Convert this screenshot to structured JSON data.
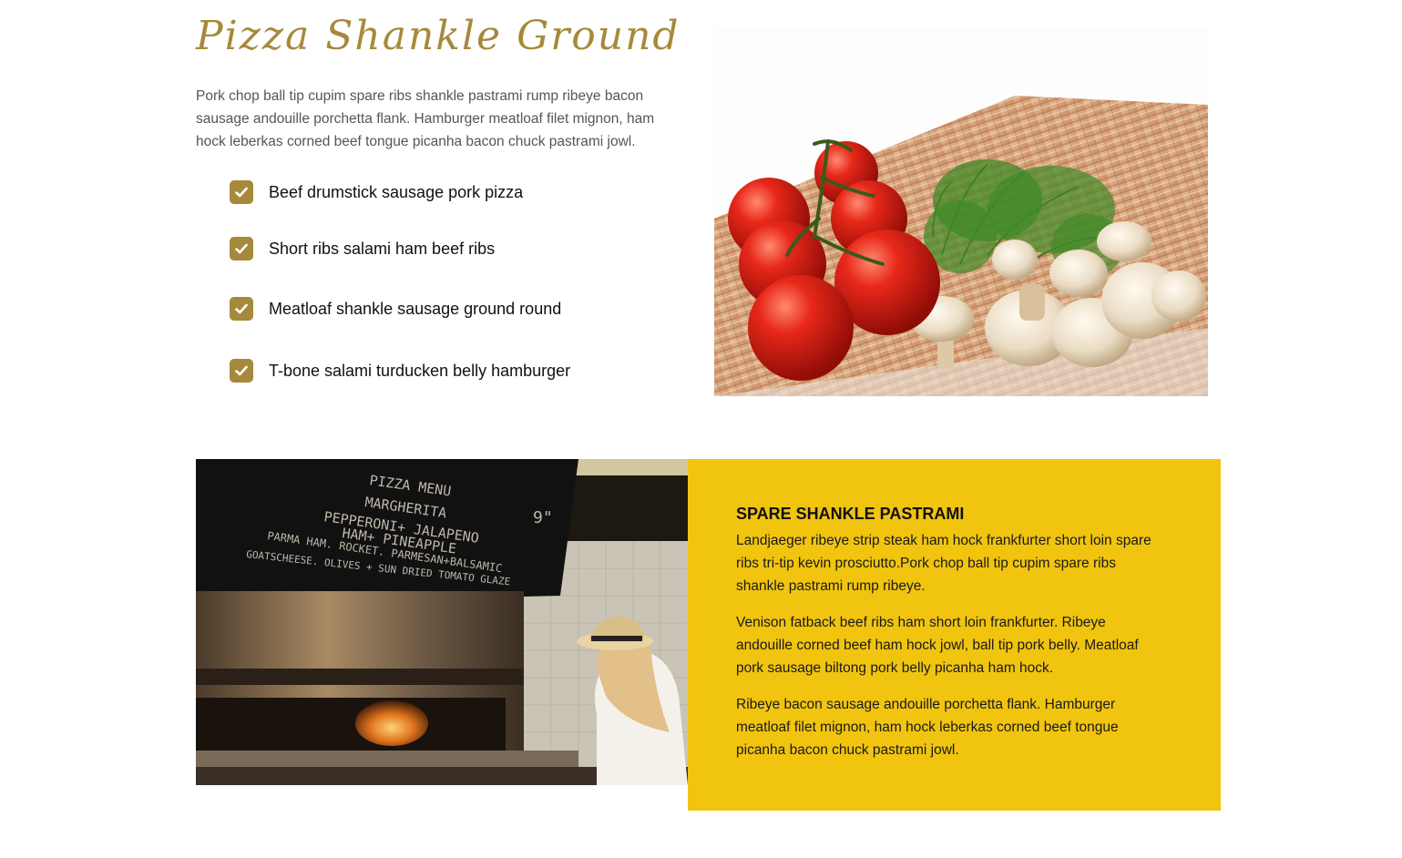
{
  "heading": {
    "title": "Pizza Shankle Ground",
    "intro": "Pork chop ball tip cupim spare ribs shankle pastrami rump ribeye bacon sausage andouille porchetta flank. Hamburger meatloaf filet mignon, ham hock leberkas corned beef tongue picanha bacon chuck pastrami jowl."
  },
  "checklist": {
    "icon": "check-icon",
    "items": [
      {
        "label": "Beef drumstick sausage pork pizza"
      },
      {
        "label": "Short ribs salami ham beef ribs"
      },
      {
        "label": "Meatloaf shankle sausage ground round"
      },
      {
        "label": "T-bone salami turducken belly hamburger"
      }
    ]
  },
  "images": {
    "vegetables": "tomatoes-dill-mushrooms-photo",
    "oven": "pizza-oven-chef-photo"
  },
  "menu_board": {
    "lines": [
      "PIZZA MENU",
      "MARGHERITA",
      "PEPPERONI+ JALAPENO",
      "HAM+ PINEAPPLE",
      "PARMA HAM. ROCKET. PARMESAN+BALSAMIC",
      "GOATSCHEESE. OLIVES + SUN DRIED TOMATO GLAZE"
    ],
    "size": "9\""
  },
  "info_card": {
    "title": "SPARE SHANKLE PASTRAMI",
    "paragraphs": [
      "Landjaeger ribeye strip steak ham hock frankfurter short loin spare ribs tri-tip kevin prosciutto.Pork chop ball tip cupim spare ribs shankle pastrami rump ribeye.",
      "Venison fatback beef ribs ham short loin frankfurter. Ribeye andouille corned beef ham hock jowl, ball tip pork belly. Meatloaf pork sausage biltong pork belly picanha ham hock.",
      "Ribeye bacon sausage andouille porchetta flank. Hamburger meatloaf filet mignon, ham hock leberkas corned beef tongue picanha bacon chuck pastrami jowl."
    ]
  },
  "colors": {
    "accent_gold": "#a6893a",
    "card_yellow": "#f1c40f"
  }
}
